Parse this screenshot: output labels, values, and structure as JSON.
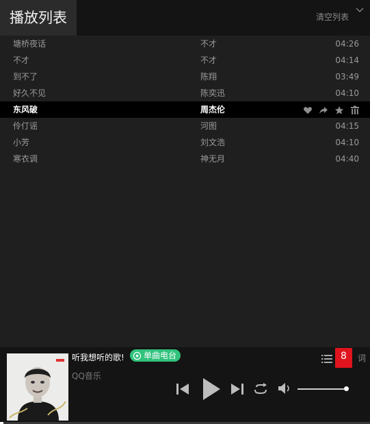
{
  "header": {
    "title": "播放列表",
    "clear_label": "清空列表"
  },
  "playlist": [
    {
      "song": "塘桥夜话",
      "artist": "不才",
      "duration": "04:26"
    },
    {
      "song": "不才",
      "artist": "不才",
      "duration": "04:14"
    },
    {
      "song": "到不了",
      "artist": "陈翔",
      "duration": "03:49"
    },
    {
      "song": "好久不见",
      "artist": "陈奕迅",
      "duration": "04:10"
    },
    {
      "song": "东风破",
      "artist": "周杰伦",
      "duration": ""
    },
    {
      "song": "伶仃谣",
      "artist": "河图",
      "duration": "04:15"
    },
    {
      "song": "小芳",
      "artist": "刘文浩",
      "duration": "04:10"
    },
    {
      "song": "寒衣调",
      "artist": "神无月",
      "duration": "04:40"
    }
  ],
  "active_index": 4,
  "player": {
    "title": "听我想听的歌!",
    "radio_label": "单曲电台",
    "artist": "QQ音乐",
    "count": "8",
    "lyric_label": "词",
    "volume": 0.95,
    "progress": 0.01
  },
  "colors": {
    "accent_green": "#31c27c",
    "badge_red": "#e0141e"
  },
  "icons": [
    "chevron-down-icon",
    "heart-icon",
    "share-icon",
    "star-icon",
    "delete-icon",
    "radio-icon",
    "list-icon",
    "prev-icon",
    "play-icon",
    "next-icon",
    "repeat-icon",
    "volume-icon"
  ]
}
